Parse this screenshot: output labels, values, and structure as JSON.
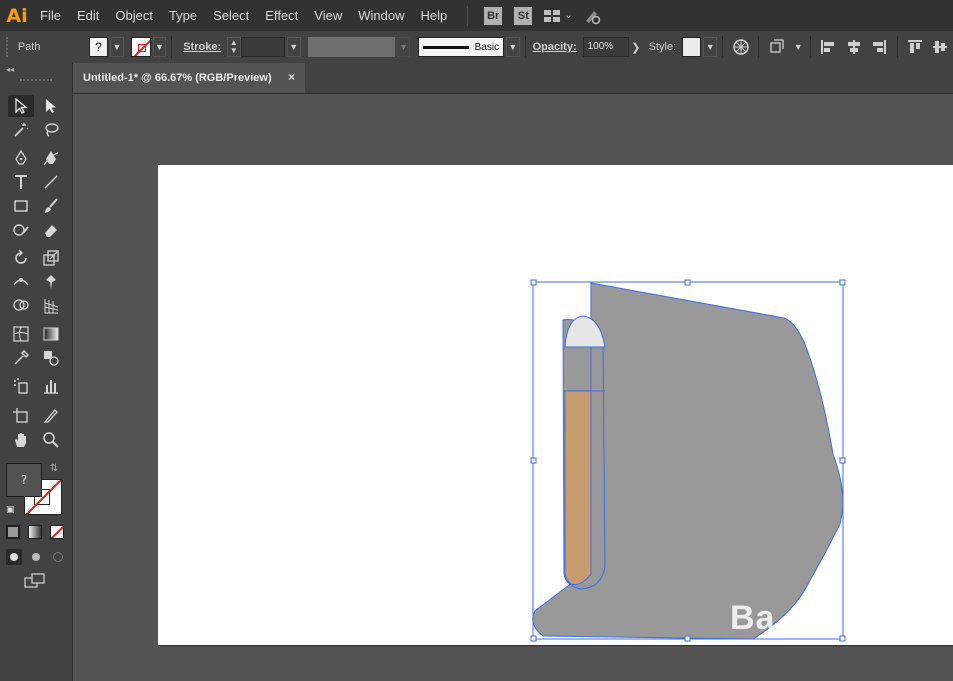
{
  "app": {
    "logo": "Ai"
  },
  "menu": [
    "File",
    "Edit",
    "Object",
    "Type",
    "Select",
    "Effect",
    "View",
    "Window",
    "Help"
  ],
  "menubar_icons": {
    "bridge": "Br",
    "stock": "St"
  },
  "control_bar": {
    "selection_type": "Path",
    "fill_swatch": "?",
    "stroke_label": "Stroke:",
    "brush_label": "Basic",
    "opacity_label": "Opacity:",
    "opacity_value": "100%",
    "style_label": "Style:"
  },
  "tabs": [
    {
      "label": "Untitled-1* @ 66.67% (RGB/Preview)",
      "close": "×"
    }
  ],
  "toolbar": {
    "fill_label": "?",
    "collapse": "◂◂"
  },
  "colors": {
    "accent": "#ff9a00",
    "selection_blue": "#3c6ee6",
    "shape_gray": "#999999",
    "shape_tan": "#c79c6e",
    "shape_light": "#e6e6e6"
  },
  "watermark": "Ba"
}
